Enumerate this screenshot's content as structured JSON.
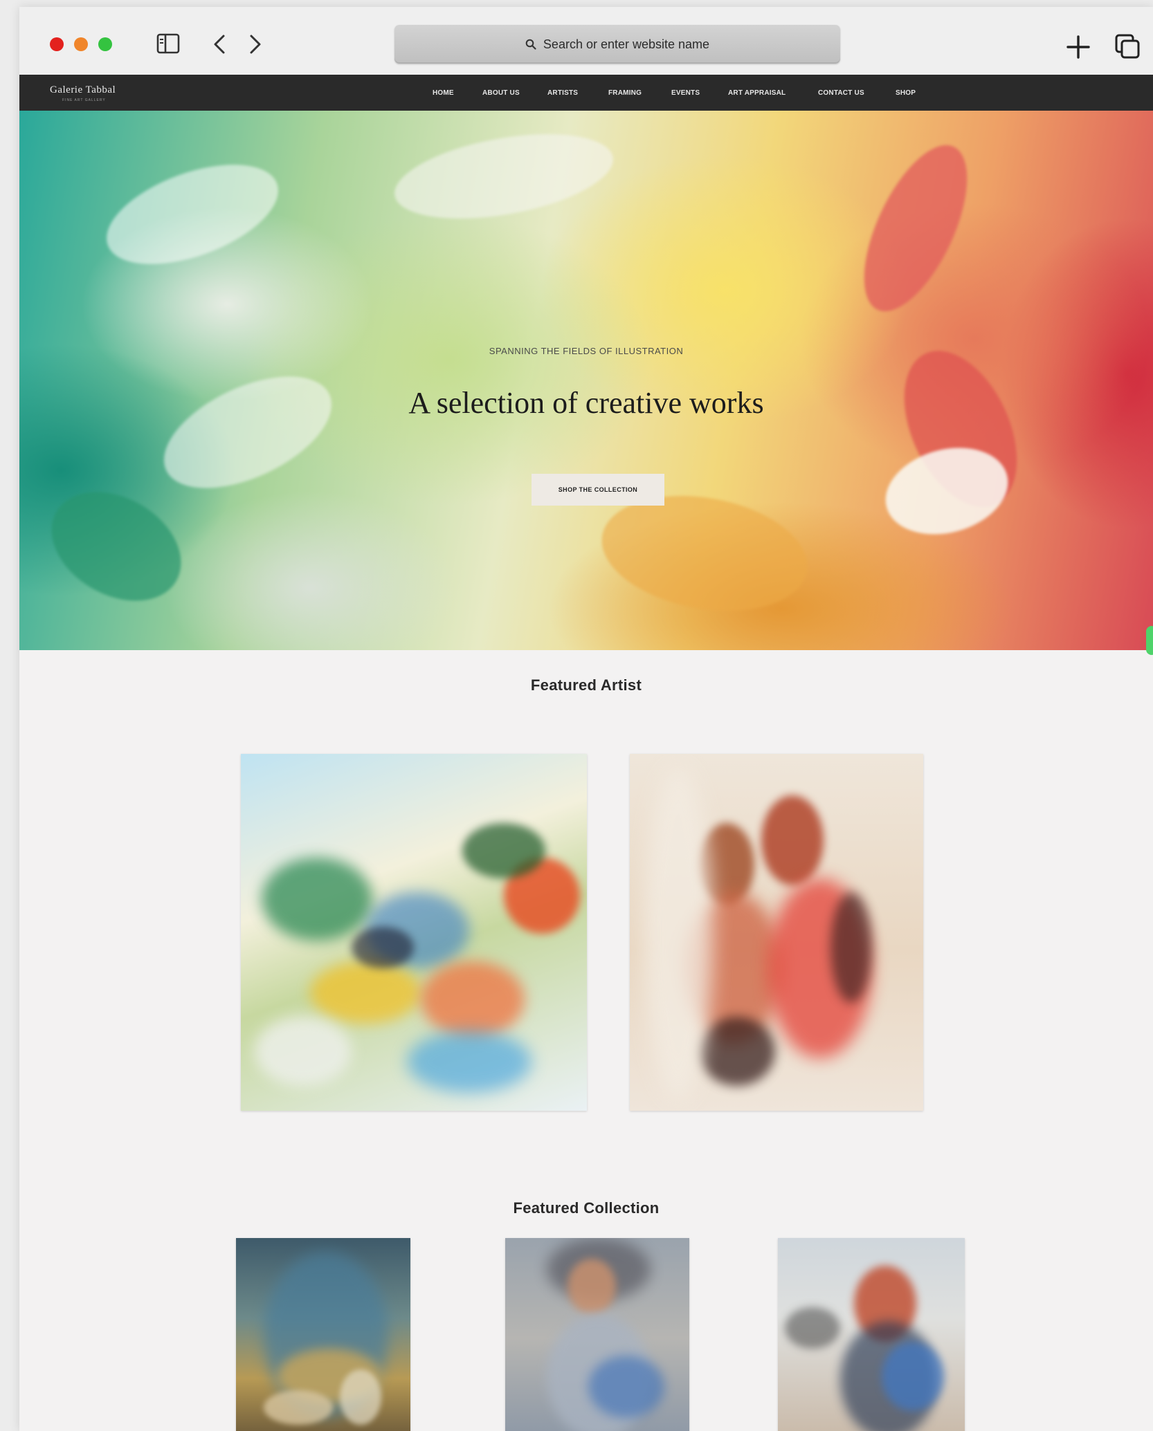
{
  "browser": {
    "address_placeholder": "Search or enter website name"
  },
  "site": {
    "logo_text": "Galerie Tabbal",
    "logo_tagline": "FINE ART GALLERY",
    "nav": [
      {
        "label": "HOME"
      },
      {
        "label": "ABOUT US"
      },
      {
        "label": "ARTISTS"
      },
      {
        "label": "FRAMING"
      },
      {
        "label": "EVENTS"
      },
      {
        "label": "ART APPRAISAL"
      },
      {
        "label": "CONTACT US"
      },
      {
        "label": "SHOP"
      }
    ]
  },
  "hero": {
    "eyebrow": "SPANNING THE FIELDS OF ILLUSTRATION",
    "title": "A selection of creative works",
    "cta_label": "SHOP THE COLLECTION"
  },
  "featured_artist": {
    "title": "Featured Artist"
  },
  "featured_collection": {
    "title": "Featured Collection"
  },
  "colors": {
    "traffic_red": "#e3211d",
    "traffic_orange": "#f0852a",
    "traffic_green": "#34c340",
    "nav_bg": "#2a2a2a",
    "page_bg": "#f3f2f2"
  }
}
